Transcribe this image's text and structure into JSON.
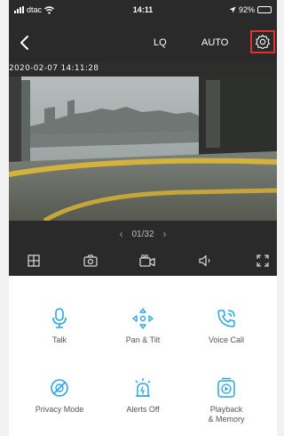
{
  "status_bar": {
    "carrier": "dtac",
    "time": "14:11",
    "battery": "92%",
    "battery_level": 0.92
  },
  "header": {
    "quality": "LQ",
    "mode": "AUTO"
  },
  "video": {
    "timestamp": "2020-02-07 14:11:28"
  },
  "pager": {
    "page": "01/32"
  },
  "actions": {
    "talk": "Talk",
    "pan_tilt": "Pan & Tilt",
    "voice_call": "Voice Call",
    "privacy_mode": "Privacy Mode",
    "alerts_off": "Alerts Off",
    "playback_line1": "Playback",
    "playback_line2": "& Memory"
  },
  "colors": {
    "accent": "#2aa7e0",
    "highlight_border": "#e2322b",
    "dark_background": "#2a2a2a"
  },
  "icons": [
    "back-icon",
    "settings-icon",
    "grid-icon",
    "camera-icon",
    "record-icon",
    "speaker-icon",
    "fullscreen-icon",
    "microphone-icon",
    "pan-tilt-icon",
    "phone-icon",
    "privacy-icon",
    "alert-icon",
    "playback-icon"
  ]
}
